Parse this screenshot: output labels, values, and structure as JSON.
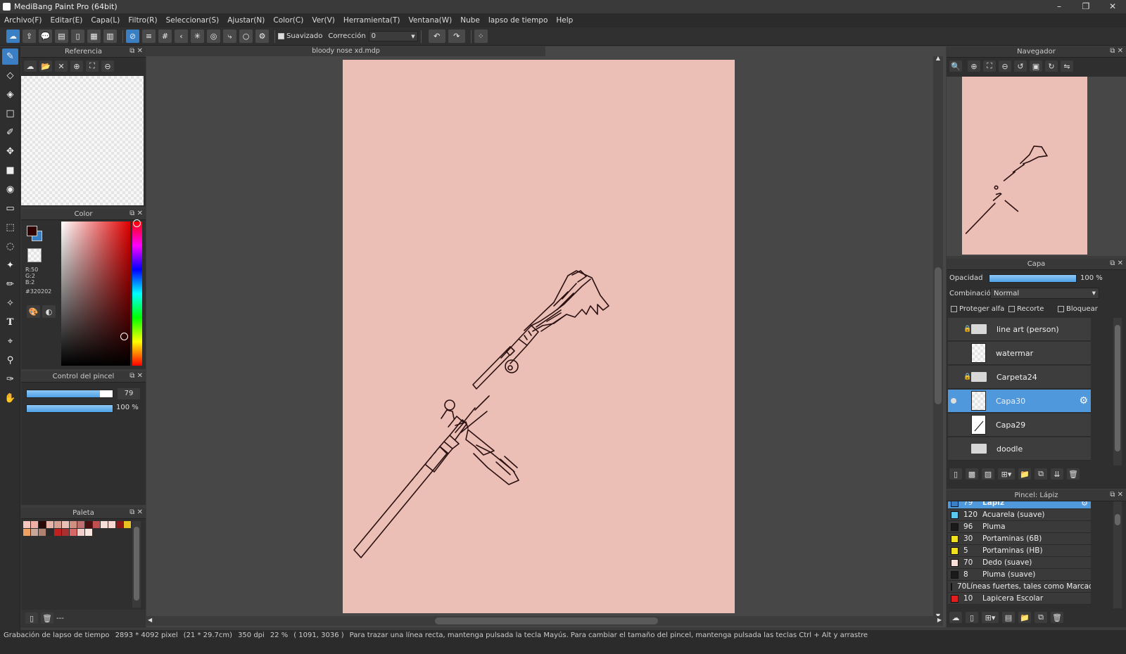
{
  "window": {
    "title": "MediBang Paint Pro (64bit)",
    "controls": [
      "–",
      "❐",
      "✕"
    ]
  },
  "menu": [
    "Archivo(F)",
    "Editar(E)",
    "Capa(L)",
    "Filtro(R)",
    "Seleccionar(S)",
    "Ajustar(N)",
    "Color(C)",
    "Ver(V)",
    "Herramienta(T)",
    "Ventana(W)",
    "Nube",
    "lapso de tiempo",
    "Help"
  ],
  "toolbar": {
    "smoothing_label": "Suavizado",
    "correction_label": "Corrección",
    "correction_value": "0"
  },
  "reference_panel": {
    "title": "Referencia"
  },
  "color_panel": {
    "title": "Color",
    "r": "R:50",
    "g": "G:2",
    "b": "B:2",
    "hex": "#320202",
    "primary": "#320202",
    "secondary": "#3a7fc4"
  },
  "brush_control": {
    "title": "Control del pincel",
    "size": "79",
    "size_fill": 0.85,
    "opacity": "100 %",
    "opacity_fill": 1.0
  },
  "palette_panel": {
    "title": "Paleta",
    "footer": "---",
    "colors": [
      "#f6c6c0",
      "#f0b0a8",
      "#2a0a08",
      "#e8b4a8",
      "#d8a090",
      "#e8c0b8",
      "#d09080",
      "#c07070",
      "#4a1010",
      "#c05050",
      "#f4e0d8",
      "#f8d8d0",
      "#8a1818",
      "#e8c020",
      "#f0a060",
      "#c8a898",
      "#b08070",
      "#2a2a2a",
      "#c02020",
      "#a83030",
      "#d86868",
      "#f0d0c8",
      "#f8e8e0"
    ]
  },
  "document": {
    "tab": "bloody nose xd.mdp",
    "bg": "#ebbfb6"
  },
  "navigator": {
    "title": "Navegador"
  },
  "layer_panel": {
    "title": "Capa",
    "opacity_label": "Opacidad",
    "opacity_value": "100 %",
    "blend_label": "Combinación",
    "blend_value": "Normal",
    "protect_alpha": "Proteger alfa",
    "clip": "Recorte",
    "lock": "Bloquear",
    "layers": [
      {
        "name": "line art (person)",
        "type": "folder",
        "locked": true
      },
      {
        "name": "watermar",
        "type": "layer",
        "locked": false
      },
      {
        "name": "Carpeta24",
        "type": "folder",
        "locked": true
      },
      {
        "name": "Capa30",
        "type": "layer",
        "locked": false,
        "selected": true
      },
      {
        "name": "Capa29",
        "type": "layer",
        "locked": false
      },
      {
        "name": "doodle",
        "type": "folder",
        "locked": false
      }
    ]
  },
  "brush_panel": {
    "title": "Pincel: Lápiz",
    "brushes": [
      {
        "size": "79",
        "name": "Lápiz",
        "color": "#3a7fc4",
        "selected": true
      },
      {
        "size": "120",
        "name": "Acuarela (suave)",
        "color": "#5bc8f0"
      },
      {
        "size": "96",
        "name": "Pluma",
        "color": "#1a1a1a"
      },
      {
        "size": "30",
        "name": "Portaminas (6B)",
        "color": "#f0e020"
      },
      {
        "size": "5",
        "name": "Portaminas (HB)",
        "color": "#f0e020"
      },
      {
        "size": "70",
        "name": "Dedo (suave)",
        "color": "#f8e0d8"
      },
      {
        "size": "8",
        "name": "Pluma (suave)",
        "color": "#1a1a1a"
      },
      {
        "size": "70",
        "name": "Líneas fuertes, tales como Marcad",
        "color": "#e02020"
      },
      {
        "size": "10",
        "name": "Lapicera Escolar",
        "color": "#e02020"
      }
    ]
  },
  "status": {
    "items": [
      "Grabación de lapso de tiempo",
      "2893 * 4092 pixel",
      "(21 * 29.7cm)",
      "350 dpi",
      "22 %",
      "( 1091, 3036 )",
      "Para trazar una línea recta, mantenga pulsada la tecla Mayús. Para cambiar el tamaño del pincel, mantenga pulsada las teclas Ctrl + Alt y arrastre"
    ]
  }
}
